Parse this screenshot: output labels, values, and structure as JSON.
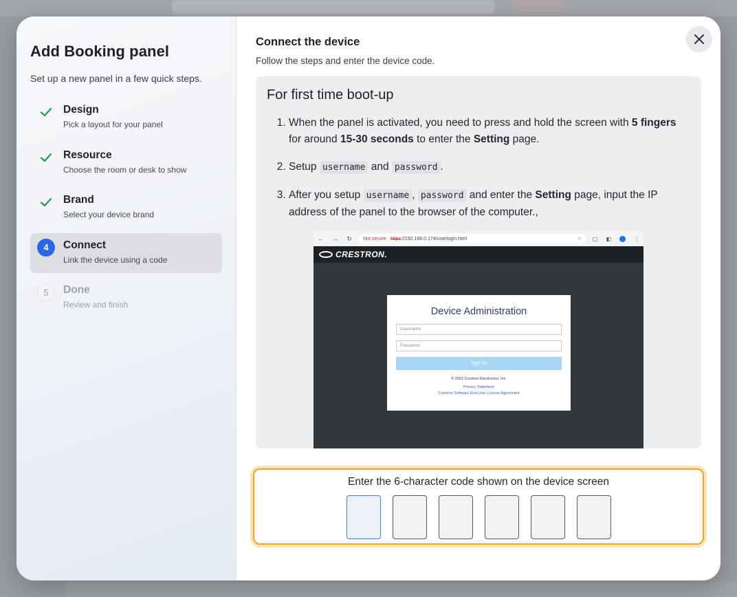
{
  "panel": {
    "title": "Add Booking panel",
    "subtitle": "Set up a new panel in a few quick steps."
  },
  "steps": [
    {
      "title": "Design",
      "desc": "Pick a layout for your panel",
      "state": "done"
    },
    {
      "title": "Resource",
      "desc": "Choose the room or desk to show",
      "state": "done"
    },
    {
      "title": "Brand",
      "desc": "Select your device brand",
      "state": "done"
    },
    {
      "number": "4",
      "title": "Connect",
      "desc": "Link the device using a code",
      "state": "current"
    },
    {
      "number": "5",
      "title": "Done",
      "desc": "Review and finish",
      "state": "pending"
    }
  ],
  "main": {
    "title": "Connect the device",
    "lead": "Follow the steps and enter the device code.",
    "box_title": "For first time boot-up",
    "instructions": {
      "s1_a": "When the panel is activated, you need to press and hold the screen with ",
      "s1_b": "5 fingers",
      "s1_c": " for around ",
      "s1_d": "15-30 seconds",
      "s1_e": " to enter the ",
      "s1_f": "Setting",
      "s1_g": " page.",
      "s2_a": "Setup ",
      "s2_code1": "username",
      "s2_b": " and ",
      "s2_code2": "password",
      "s2_c": ".",
      "s3_a": "After you setup ",
      "s3_code1": "username",
      "s3_b": ", ",
      "s3_code2": "password",
      "s3_c": " and enter the ",
      "s3_d": "Setting",
      "s3_e": " page, input the IP address of the panel to the browser of the computer.,"
    }
  },
  "screenshot": {
    "not_secure": "Not secure",
    "url_scheme": "https",
    "url_rest": "://192.168.0.174/userlogin.html",
    "brand": "CRESTRON.",
    "card_title": "Device Administration",
    "username_placeholder": "Username",
    "password_placeholder": "Password",
    "sign_in": "Sign In",
    "copyright": "© 2022 Crestron Electronics, Inc.",
    "privacy": "Privacy Statement",
    "license": "Crestron Software End-User License Agreement"
  },
  "code": {
    "label": "Enter the 6-character code shown on the device screen",
    "length": 6
  },
  "colors": {
    "accent": "#2b66e3",
    "check": "#1f9d4a",
    "highlight": "#f0a32a"
  }
}
